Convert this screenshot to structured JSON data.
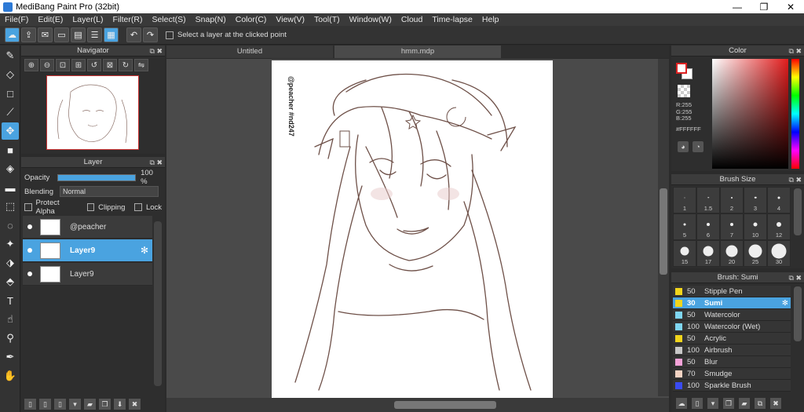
{
  "window": {
    "title": "MediBang Paint Pro (32bit)",
    "minimize": "—",
    "maximize": "❐",
    "close": "✕"
  },
  "menu": [
    "File(F)",
    "Edit(E)",
    "Layer(L)",
    "Filter(R)",
    "Select(S)",
    "Snap(N)",
    "Color(C)",
    "View(V)",
    "Tool(T)",
    "Window(W)",
    "Cloud",
    "Time-lapse",
    "Help"
  ],
  "toolbar": {
    "option_label": "Select a layer at the clicked point"
  },
  "navigator": {
    "title": "Navigator"
  },
  "layer_panel": {
    "title": "Layer",
    "opacity_label": "Opacity",
    "opacity_value": "100 %",
    "opacity_fraction": 1.0,
    "blending_label": "Blending",
    "blending_value": "Normal",
    "protect_alpha": "Protect Alpha",
    "clipping": "Clipping",
    "lock": "Lock",
    "layers": [
      {
        "name": "@peacher",
        "selected": false
      },
      {
        "name": "Layer9",
        "selected": true
      },
      {
        "name": "Layer9",
        "selected": false
      }
    ]
  },
  "tabs": [
    {
      "label": "Untitled",
      "active": false
    },
    {
      "label": "hmm.mdp",
      "active": true
    }
  ],
  "canvas": {
    "signature": "@peacher #nd247"
  },
  "color_panel": {
    "title": "Color",
    "r": "R:255",
    "g": "G:255",
    "b": "B:255",
    "hex": "#FFFFFF"
  },
  "brush_size": {
    "title": "Brush Size",
    "sizes": [
      "1",
      "1.5",
      "2",
      "3",
      "4",
      "5",
      "6",
      "7",
      "10",
      "12",
      "15",
      "17",
      "20",
      "25",
      "30"
    ]
  },
  "brush_panel": {
    "title": "Brush: Sumi",
    "brushes": [
      {
        "size": "50",
        "name": "Stipple Pen",
        "color": "#f1d51c",
        "selected": false
      },
      {
        "size": "30",
        "name": "Sumi",
        "color": "#f1d51c",
        "selected": true
      },
      {
        "size": "50",
        "name": "Watercolor",
        "color": "#7fd6f2",
        "selected": false
      },
      {
        "size": "100",
        "name": "Watercolor (Wet)",
        "color": "#7fd6f2",
        "selected": false
      },
      {
        "size": "50",
        "name": "Acrylic",
        "color": "#f1d51c",
        "selected": false
      },
      {
        "size": "100",
        "name": "Airbrush",
        "color": "#c8c8c8",
        "selected": false
      },
      {
        "size": "50",
        "name": "Blur",
        "color": "#f5a3d9",
        "selected": false
      },
      {
        "size": "70",
        "name": "Smudge",
        "color": "#f3d3c3",
        "selected": false
      },
      {
        "size": "100",
        "name": "Sparkle Brush",
        "color": "#3a4bf2",
        "selected": false
      }
    ]
  }
}
